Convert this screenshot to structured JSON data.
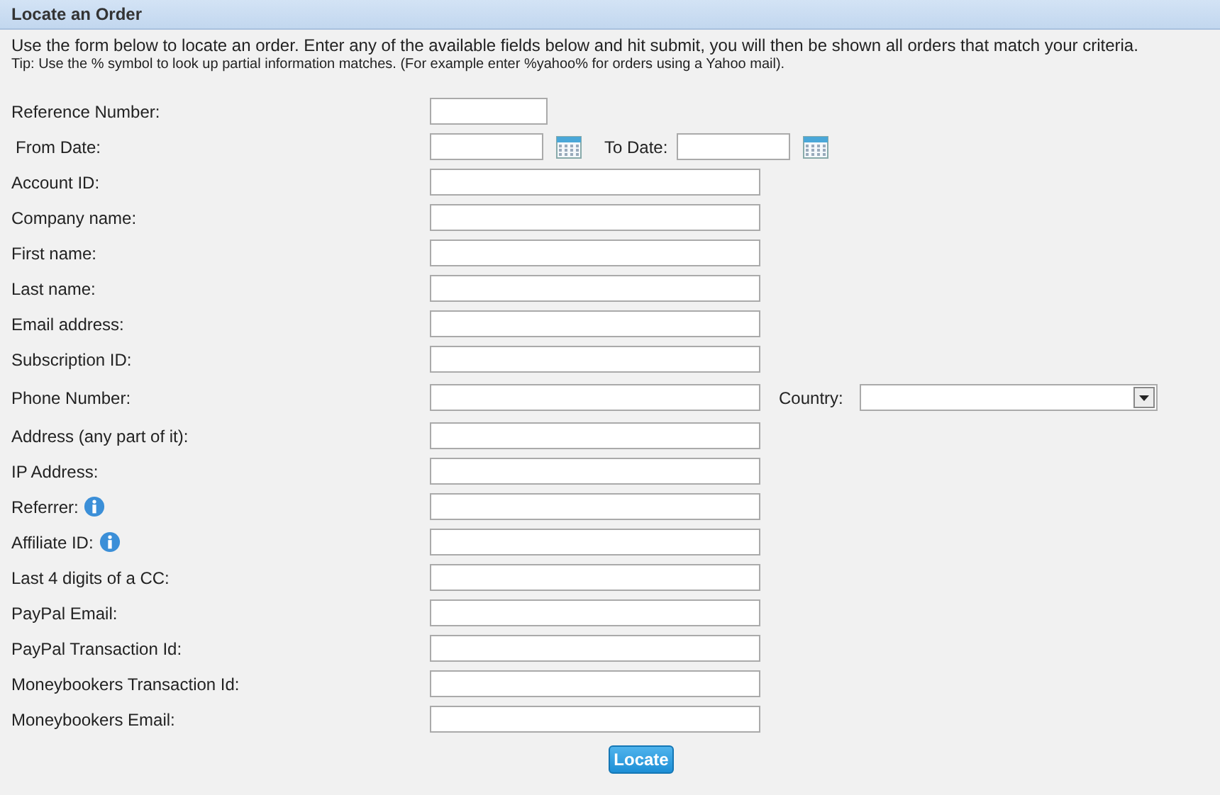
{
  "header": {
    "title": "Locate an Order"
  },
  "intro": "Use the form below to locate an order. Enter any of the available fields below and hit submit, you will then be shown all orders that match your criteria.",
  "tip": "Tip: Use the % symbol to look up partial information matches. (For example enter %yahoo% for orders using a Yahoo mail).",
  "rows": [
    {
      "kind": "short",
      "label": "Reference Number:",
      "info": false
    },
    {
      "kind": "dates",
      "label": "From Date:",
      "info": false,
      "to_label": "To Date:"
    },
    {
      "kind": "text",
      "label": "Account ID:",
      "info": false
    },
    {
      "kind": "text",
      "label": "Company name:",
      "info": false
    },
    {
      "kind": "text",
      "label": "First name:",
      "info": false
    },
    {
      "kind": "text",
      "label": "Last name:",
      "info": false
    },
    {
      "kind": "text",
      "label": "Email address:",
      "info": false
    },
    {
      "kind": "text",
      "label": "Subscription ID:",
      "info": false
    },
    {
      "kind": "phone",
      "label": "Phone Number:",
      "info": false,
      "country_label": "Country:"
    },
    {
      "kind": "text",
      "label": "Address (any part of it):",
      "info": false
    },
    {
      "kind": "text",
      "label": "IP Address:",
      "info": false
    },
    {
      "kind": "text",
      "label": "Referrer:",
      "info": true
    },
    {
      "kind": "text",
      "label": "Affiliate ID:",
      "info": true
    },
    {
      "kind": "text",
      "label": "Last 4 digits of a CC:",
      "info": false
    },
    {
      "kind": "text",
      "label": "PayPal Email:",
      "info": false
    },
    {
      "kind": "text",
      "label": "PayPal Transaction Id:",
      "info": false
    },
    {
      "kind": "text",
      "label": "Moneybookers Transaction Id:",
      "info": false
    },
    {
      "kind": "text",
      "label": "Moneybookers Email:",
      "info": false
    }
  ],
  "submit": {
    "label": "Locate"
  }
}
